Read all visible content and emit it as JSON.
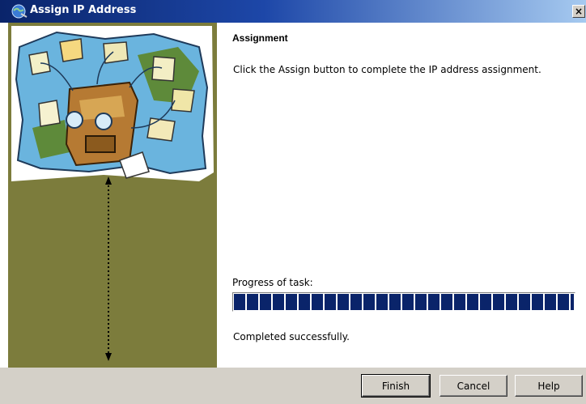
{
  "window": {
    "title": "Assign IP Address",
    "close_glyph": "×"
  },
  "page": {
    "heading": "Assignment",
    "description": "Click the Assign button to complete the IP address assignment."
  },
  "progress": {
    "label": "Progress of task:",
    "value_fraction": 1.0,
    "status": "Completed successfully."
  },
  "buttons": {
    "finish": "Finish",
    "cancel": "Cancel",
    "help": "Help"
  },
  "colors": {
    "title_bar": "#0a246a",
    "side_panel": "#7c7c3c",
    "progress_block": "#0a246a",
    "button_face": "#d4d0c8"
  },
  "icons": {
    "app": "network-globe-icon",
    "close": "close-icon",
    "illustration": "wizard-illustration"
  }
}
